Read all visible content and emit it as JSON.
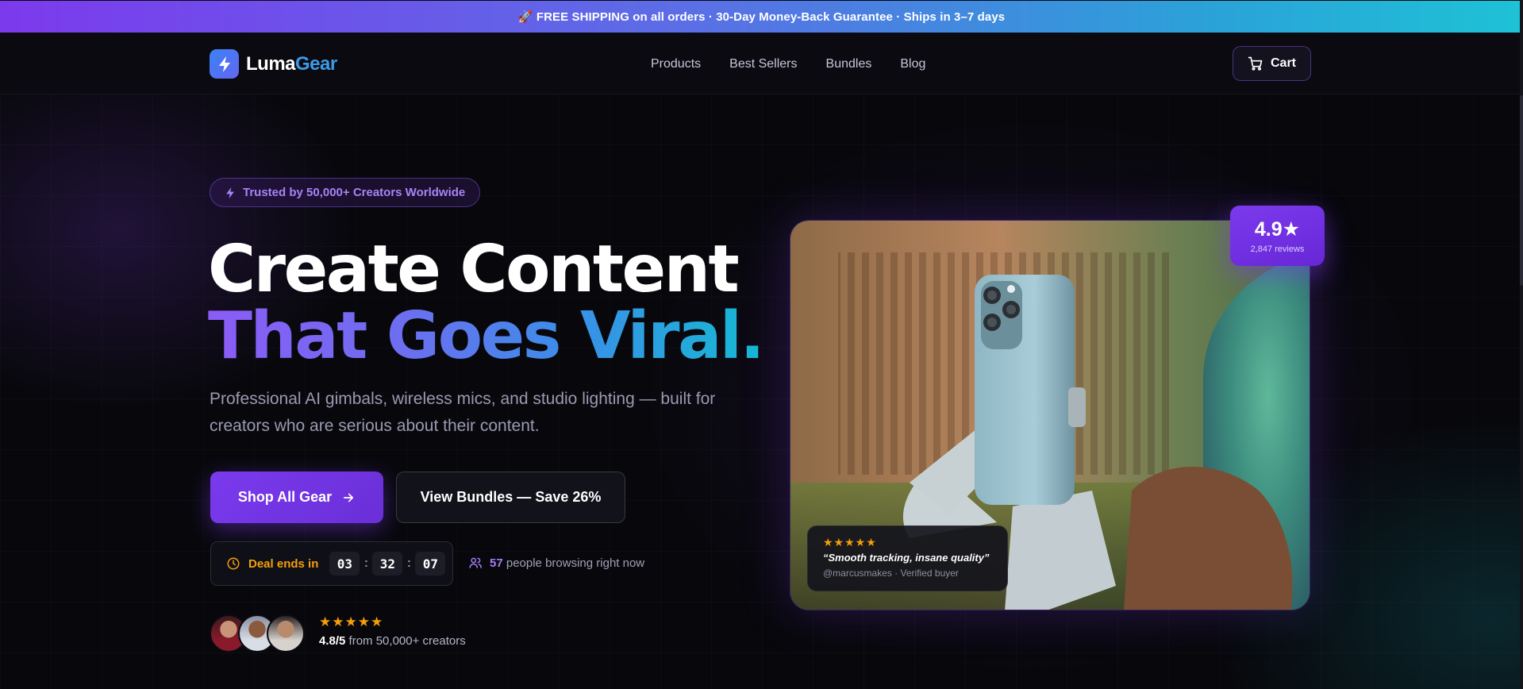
{
  "announcement": {
    "icon": "rocket-icon",
    "text": "🚀 FREE SHIPPING on all orders · 30-Day Money-Back Guarantee · Ships in 3–7 days"
  },
  "header": {
    "logo_part1": "Luma",
    "logo_part2": "Gear",
    "nav": [
      "Products",
      "Best Sellers",
      "Bundles",
      "Blog"
    ],
    "cart_label": "Cart"
  },
  "hero": {
    "badge": "Trusted by 50,000+ Creators Worldwide",
    "title_line1": "Create Content",
    "title_line2": "That Goes Viral.",
    "subtitle": "Professional AI gimbals, wireless mics, and studio lighting — built for creators who are serious about their content.",
    "primary_cta": "Shop All Gear",
    "secondary_cta": "View Bundles — Save 26%",
    "deal_label": "Deal ends in",
    "countdown": {
      "hours": "03",
      "minutes": "32",
      "seconds": "07"
    },
    "browsing_count": "57",
    "browsing_text": "people browsing right now",
    "social_stars": "★★★★★",
    "social_rating": "4.8/5",
    "social_text": "from 50,000+ creators"
  },
  "product": {
    "rating_score": "4.9★",
    "rating_reviews": "2,847 reviews",
    "review_stars": "★★★★★",
    "review_quote": "“Smooth tracking, insane quality”",
    "review_author": "@marcusmakes · Verified buyer"
  },
  "colors": {
    "accent_purple": "#7c3aed",
    "accent_blue": "#3b9be8",
    "accent_cyan": "#16b9d4",
    "star_orange": "#f59e0b",
    "background": "#08080c"
  }
}
